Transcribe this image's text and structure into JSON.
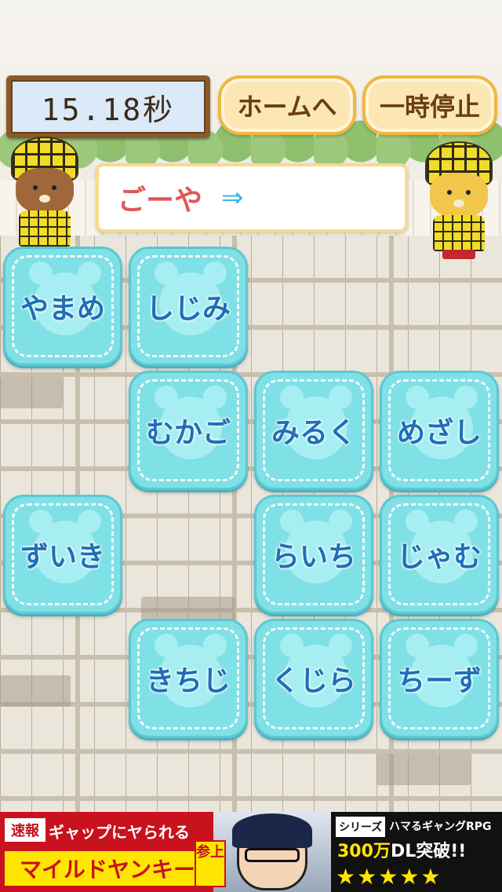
{
  "timer": {
    "text": "15.18秒"
  },
  "buttons": {
    "home": "ホームへ",
    "pause": "一時停止"
  },
  "answer": {
    "word": "ごーや",
    "arrow": "⇒"
  },
  "tiles": [
    {
      "label": "やまめ"
    },
    {
      "label": "しじみ"
    },
    {
      "label": "むかご"
    },
    {
      "label": "みるく"
    },
    {
      "label": "めざし"
    },
    {
      "label": "ずいき"
    },
    {
      "label": "らいち"
    },
    {
      "label": "じゃむ"
    },
    {
      "label": "きちじ"
    },
    {
      "label": "くじら"
    },
    {
      "label": "ちーず"
    }
  ],
  "ad": {
    "badge": "速報",
    "line1": "ギャップにヤられる",
    "line2": "マイルドヤンキー",
    "join": "参上",
    "series": "シリーズ",
    "genre": "ハマるギャングRPG",
    "dl_num": "300万",
    "dl_text": "DL突破!!",
    "stars": "★★★★★"
  },
  "colors": {
    "tile": "#7fe0e6",
    "tile_text": "#1e6fb8",
    "answer_text": "#e05757",
    "arrow": "#39b8e6",
    "button_border": "#f0b640",
    "timer_frame": "#8b5a2b"
  }
}
